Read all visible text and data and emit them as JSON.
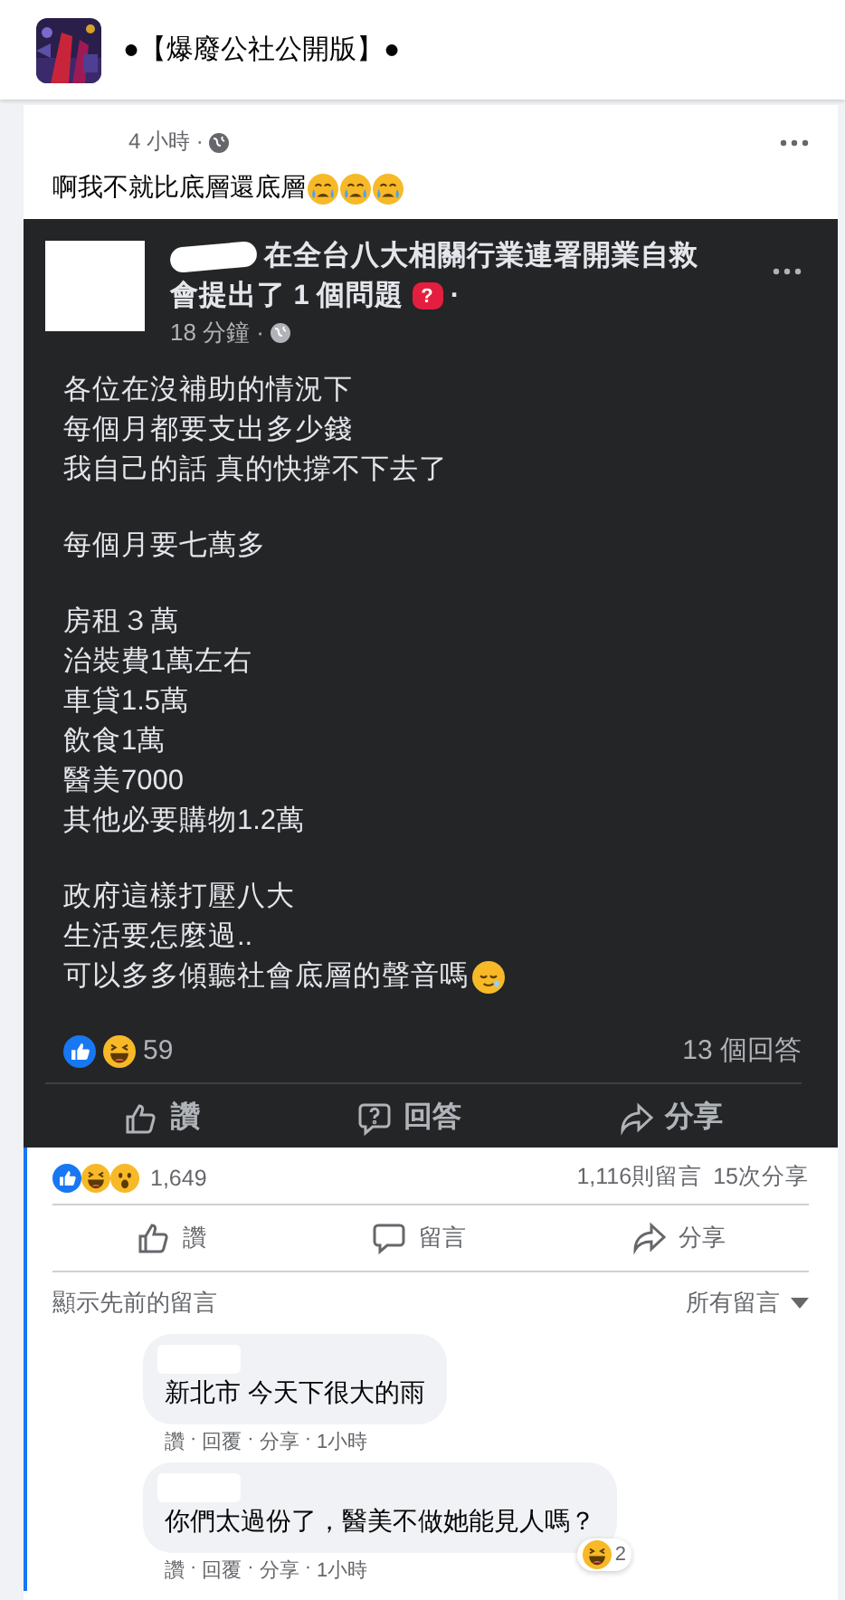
{
  "group": {
    "name": "●【爆廢公社公開版】●"
  },
  "post": {
    "time": "4 小時 ·",
    "text": "啊我不就比底層還底層"
  },
  "shared": {
    "title_line1": "在全台八大相關行業連署開業自救",
    "title_line2": "會提出了 1 個問題",
    "after_badge": "·",
    "badge": "?",
    "time": "18 分鐘 ·",
    "paragraphs": [
      [
        "各位在沒補助的情況下",
        "每個月都要支出多少錢",
        "我自己的話 真的快撐不下去了"
      ],
      [
        "每個月要七萬多"
      ],
      [
        "房租３萬",
        "治裝費1萬左右",
        "車貸1.5萬",
        "飲食1萬",
        "醫美7000",
        "其他必要購物1.2萬"
      ],
      [
        "政府這樣打壓八大",
        "生活要怎麼過..",
        "可以多多傾聽社會底層的聲音嗎"
      ]
    ],
    "reaction_count": "59",
    "answers": "13 個回答",
    "actions": [
      {
        "kind": "like",
        "label": "讚"
      },
      {
        "kind": "question",
        "label": "回答"
      },
      {
        "kind": "share",
        "label": "分享"
      }
    ]
  },
  "footer": {
    "reaction_count": "1,649",
    "comments": "1,116則留言",
    "shares": "15次分享",
    "actions": [
      {
        "kind": "like",
        "label": "讚"
      },
      {
        "kind": "comment",
        "label": "留言"
      },
      {
        "kind": "share",
        "label": "分享"
      }
    ],
    "show_previous": "顯示先前的留言",
    "sort": "所有留言"
  },
  "comments": [
    {
      "text": "新北市 今天下很大的雨",
      "actions": [
        "讚",
        "回覆",
        "分享",
        "1小時"
      ]
    },
    {
      "text": "你們太過份了，醫美不做她能見人嗎？",
      "reaction": {
        "kind": "haha",
        "count": "2"
      },
      "actions": [
        "讚",
        "回覆",
        "分享",
        "1小時"
      ]
    }
  ],
  "separator": "·"
}
